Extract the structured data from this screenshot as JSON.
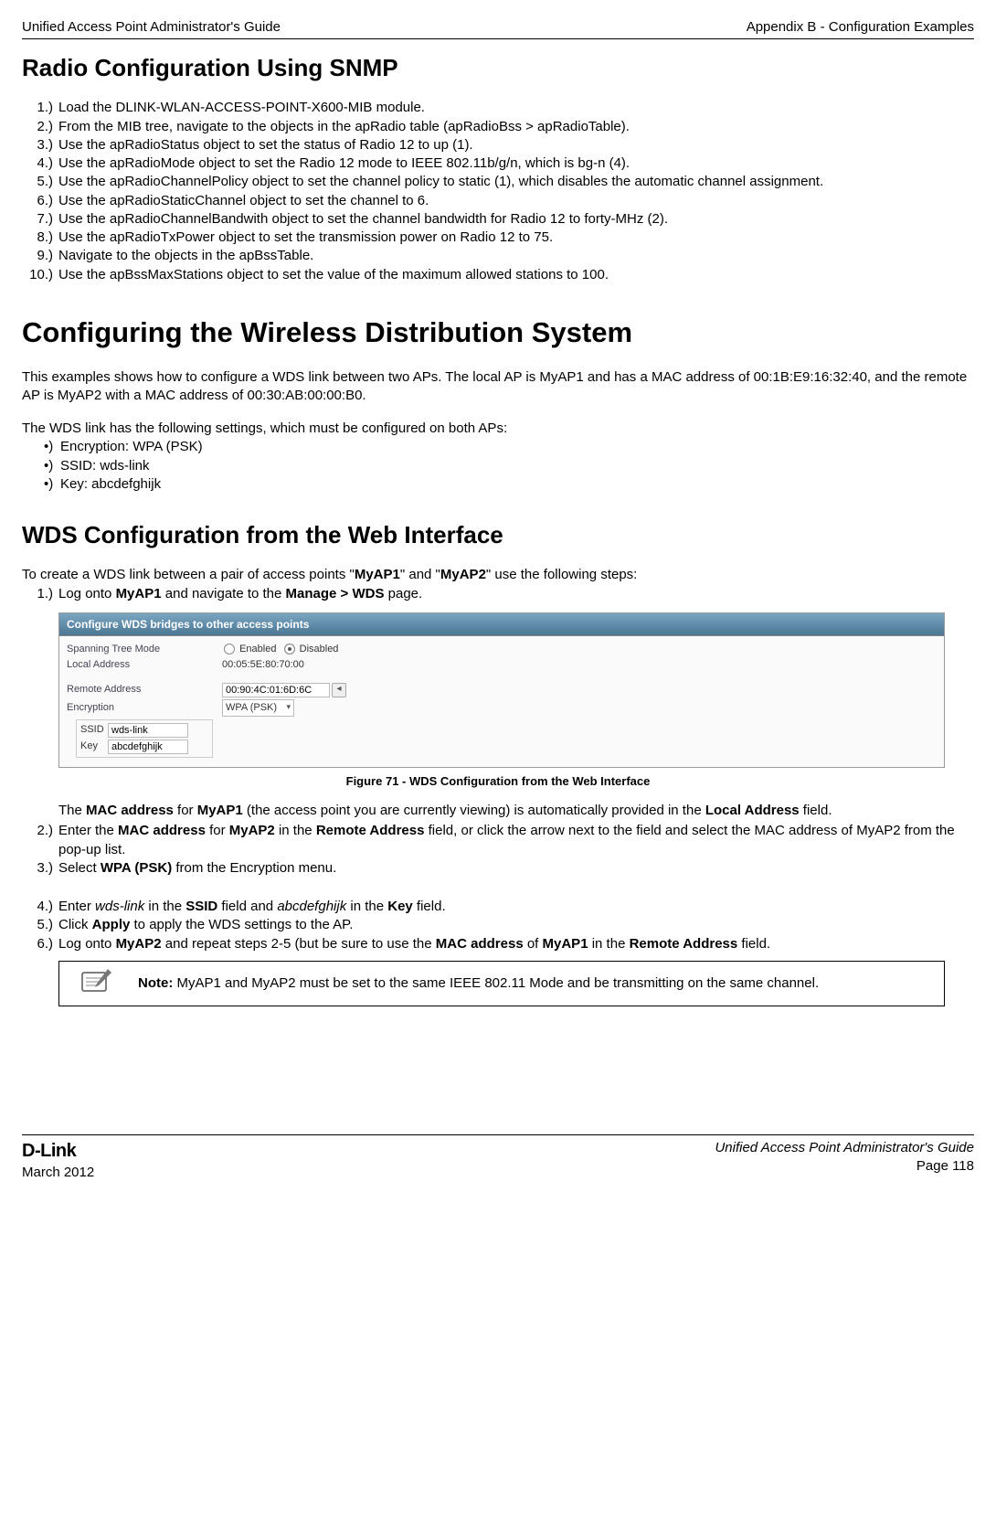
{
  "header": {
    "left": "Unified Access Point Administrator's Guide",
    "right": "Appendix B - Configuration Examples"
  },
  "h1": "Radio Configuration Using SNMP",
  "snmp_steps": [
    "Load the DLINK-WLAN-ACCESS-POINT-X600-MIB module.",
    "From the MIB tree, navigate to the objects in the apRadio table (apRadioBss > apRadioTable).",
    "Use the apRadioStatus object to set the status of Radio 12 to up (1).",
    "Use the apRadioMode object to set the Radio 12 mode to IEEE 802.11b/g/n, which is bg-n (4).",
    "Use the apRadioChannelPolicy object to set the channel policy to static (1), which disables the automatic channel assignment.",
    "Use the apRadioStaticChannel object to set the channel to 6.",
    "Use the apRadioChannelBandwith object to set the channel bandwidth for Radio 12 to forty-MHz (2).",
    "Use the apRadioTxPower object to set the transmission power on Radio 12 to 75.",
    "Navigate to the objects in the apBssTable.",
    "Use the apBssMaxStations object to set the value of the maximum allowed stations to 100."
  ],
  "h2": "Configuring the Wireless Distribution System",
  "wds_intro": "This examples shows how to configure a WDS link between two APs. The local AP is MyAP1 and has a MAC address of 00:1B:E9:16:32:40, and the remote AP is MyAP2 with a MAC address of 00:30:AB:00:00:B0.",
  "wds_settings_lead": "The WDS link has the following settings, which must be configured on both APs:",
  "wds_bullets": [
    "Encryption: WPA (PSK)",
    "SSID: wds-link",
    "Key: abcdefghijk"
  ],
  "h3": "WDS Configuration from the Web Interface",
  "wds_steps_lead_pre": "To create a WDS link between a pair of access points \"",
  "wds_steps_lead_ap1": "MyAP1",
  "wds_steps_lead_mid": "\" and \"",
  "wds_steps_lead_ap2": "MyAP2",
  "wds_steps_lead_post": "\" use the following steps:",
  "step1_pre": "Log onto ",
  "step1_b1": "MyAP1",
  "step1_mid": " and navigate to the ",
  "step1_b2": "Manage > WDS",
  "step1_post": " page.",
  "figure": {
    "title": "Configure WDS bridges to other access points",
    "spanning_label": "Spanning Tree Mode",
    "enabled": "Enabled",
    "disabled": "Disabled",
    "local_label": "Local Address",
    "local_value": "00:05:5E:80:70:00",
    "remote_label": "Remote Address",
    "remote_value": "00:90:4C:01:6D:6C",
    "enc_label": "Encryption",
    "enc_value": "WPA (PSK)",
    "ssid_label": "SSID",
    "ssid_value": "wds-link",
    "key_label": "Key",
    "key_value": "abcdefghijk"
  },
  "figure_caption": "Figure 71 - WDS Configuration from the Web Interface",
  "after_fig_line1_pre": "The ",
  "after_fig_line1_b1": "MAC address",
  "after_fig_line1_mid1": " for ",
  "after_fig_line1_b2": "MyAP1",
  "after_fig_line1_mid2": " (the access point you are currently viewing) is automatically provided in the ",
  "after_fig_line1_b3": "Local Address",
  "after_fig_line1_post": " field.",
  "step2_pre": "Enter the ",
  "step2_b1": "MAC address",
  "step2_mid1": " for ",
  "step2_b2": "MyAP2",
  "step2_mid2": " in the ",
  "step2_b3": "Remote Address",
  "step2_post": " field, or click the arrow next to the field and select the MAC address of MyAP2 from the pop-up list.",
  "step3_pre": "Select ",
  "step3_b1": "WPA (PSK)",
  "step3_post": " from the Encryption menu.",
  "step4_pre": "Enter ",
  "step4_i1": "wds-link",
  "step4_mid1": " in the ",
  "step4_b1": "SSID",
  "step4_mid2": " field and ",
  "step4_i2": "abcdefghijk",
  "step4_mid3": " in the ",
  "step4_b2": "Key",
  "step4_post": " field.",
  "step5_pre": "Click ",
  "step5_b1": "Apply",
  "step5_post": " to apply the WDS settings to the AP.",
  "step6_pre": "Log onto ",
  "step6_b1": "MyAP2",
  "step6_mid1": " and repeat steps 2-5 (but be sure to use the ",
  "step6_b2": "MAC address",
  "step6_mid2": " of ",
  "step6_b3": "MyAP1",
  "step6_mid3": " in the ",
  "step6_b4": "Remote Address",
  "step6_post": " field.",
  "note_label": "Note:",
  "note_text": " MyAP1 and MyAP2 must be set to the same IEEE 802.11 Mode and be transmitting on the same channel.",
  "footer": {
    "logo": "D-Link",
    "date": "March 2012",
    "right1": "Unified Access Point Administrator's Guide",
    "right2": "Page 118"
  }
}
